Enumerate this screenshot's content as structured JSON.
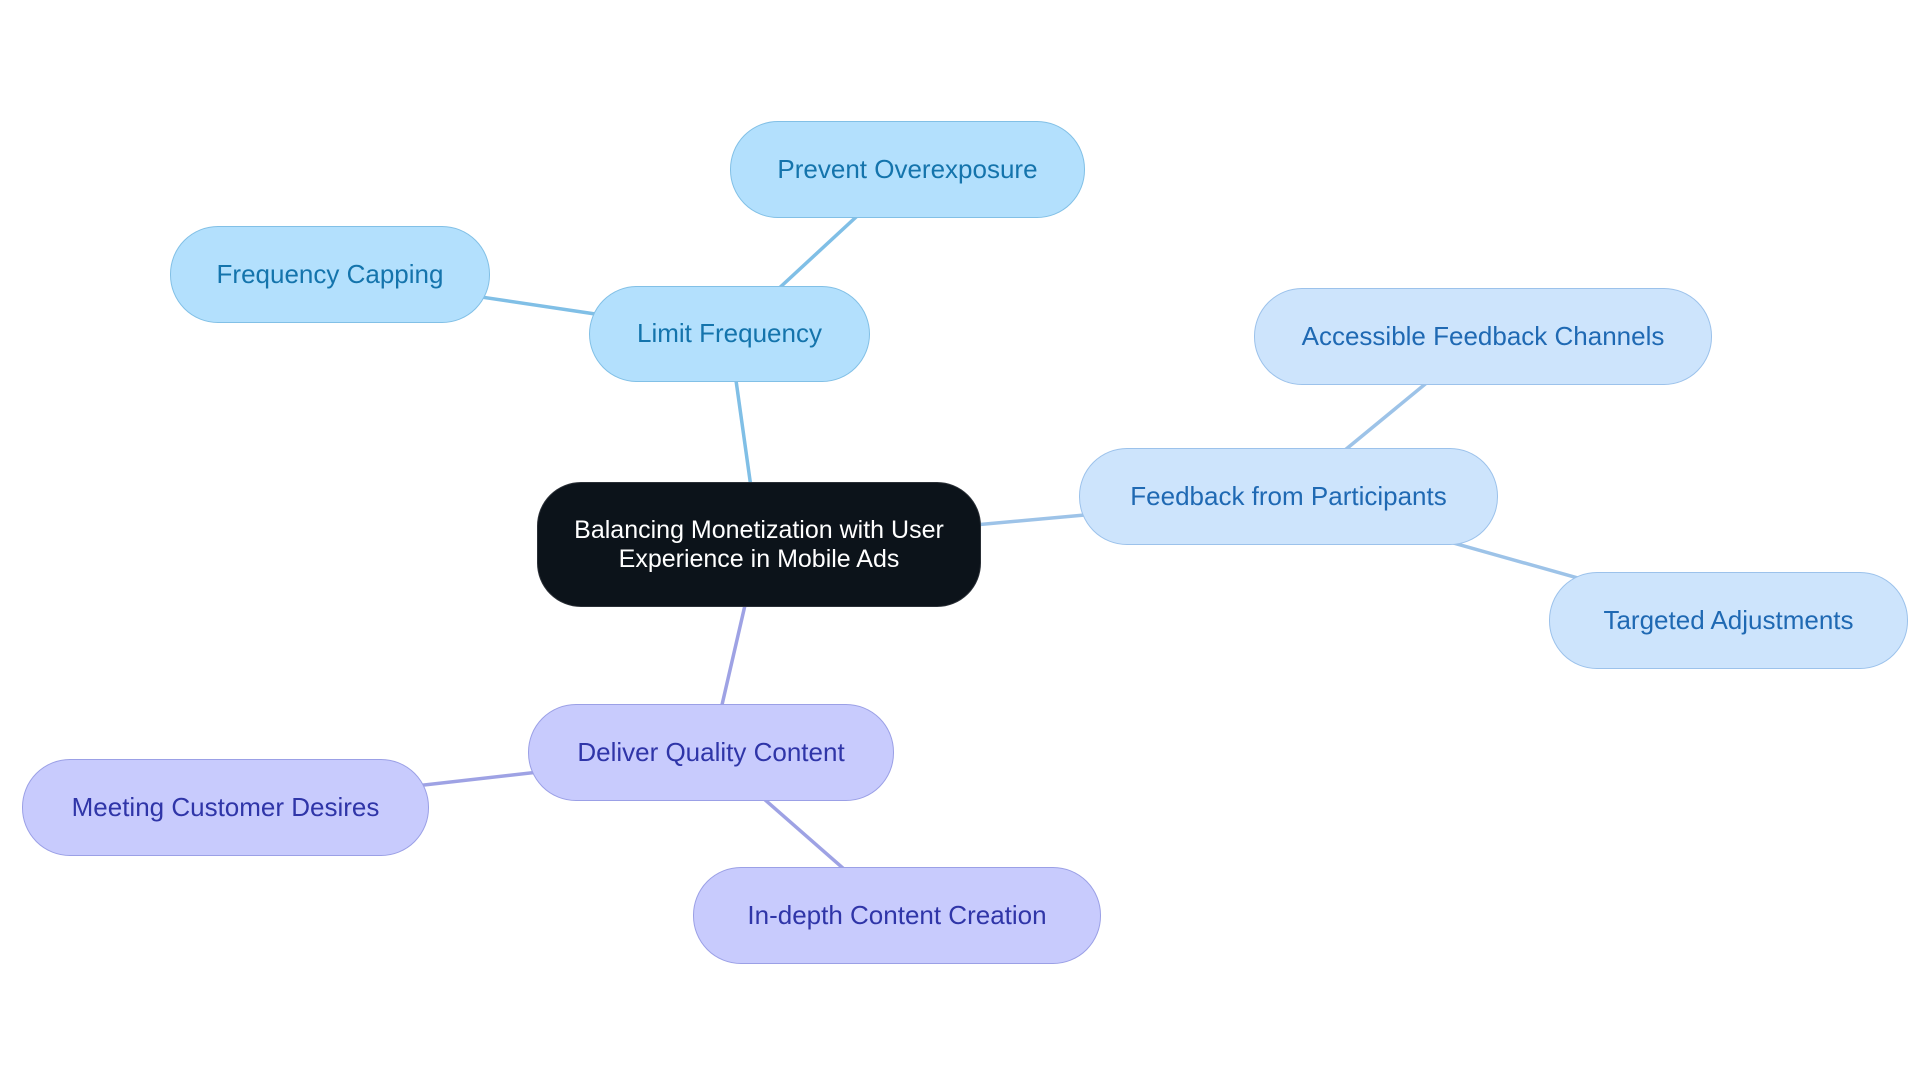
{
  "diagram": {
    "title": "Balancing Monetization with User Experience in Mobile Ads",
    "colors": {
      "root_fill": "#0c131a",
      "root_text": "#ffffff",
      "branch1_fill": "#b3e0fd",
      "branch1_border": "#82c0e6",
      "branch1_text": "#1474ac",
      "branch1_edge": "#80bfe6",
      "branch2_fill": "#cde4fc",
      "branch2_border": "#9cc2eb",
      "branch2_text": "#1f69b3",
      "branch2_edge": "#9dc3e8",
      "branch3_fill": "#c8cbfd",
      "branch3_border": "#9ba0e6",
      "branch3_text": "#2f35a8",
      "branch3_edge": "#9ea2e4"
    },
    "nodes": {
      "root": {
        "label": "Balancing Monetization with User Experience in Mobile Ads"
      },
      "limit_frequency": {
        "label": "Limit Frequency"
      },
      "prevent_overexposure": {
        "label": "Prevent Overexposure"
      },
      "frequency_capping": {
        "label": "Frequency Capping"
      },
      "feedback_participants": {
        "label": "Feedback from Participants"
      },
      "accessible_feedback": {
        "label": "Accessible Feedback Channels"
      },
      "targeted_adjustments": {
        "label": "Targeted Adjustments"
      },
      "deliver_quality": {
        "label": "Deliver Quality Content"
      },
      "meeting_desires": {
        "label": "Meeting Customer Desires"
      },
      "indepth_content": {
        "label": "In-depth Content Creation"
      }
    },
    "edges": [
      {
        "from": "root",
        "to": "limit_frequency",
        "branch": "branch1"
      },
      {
        "from": "limit_frequency",
        "to": "prevent_overexposure",
        "branch": "branch1"
      },
      {
        "from": "limit_frequency",
        "to": "frequency_capping",
        "branch": "branch1"
      },
      {
        "from": "root",
        "to": "feedback_participants",
        "branch": "branch2"
      },
      {
        "from": "feedback_participants",
        "to": "accessible_feedback",
        "branch": "branch2"
      },
      {
        "from": "feedback_participants",
        "to": "targeted_adjustments",
        "branch": "branch2"
      },
      {
        "from": "root",
        "to": "deliver_quality",
        "branch": "branch3"
      },
      {
        "from": "deliver_quality",
        "to": "meeting_desires",
        "branch": "branch3"
      },
      {
        "from": "deliver_quality",
        "to": "indepth_content",
        "branch": "branch3"
      }
    ]
  }
}
